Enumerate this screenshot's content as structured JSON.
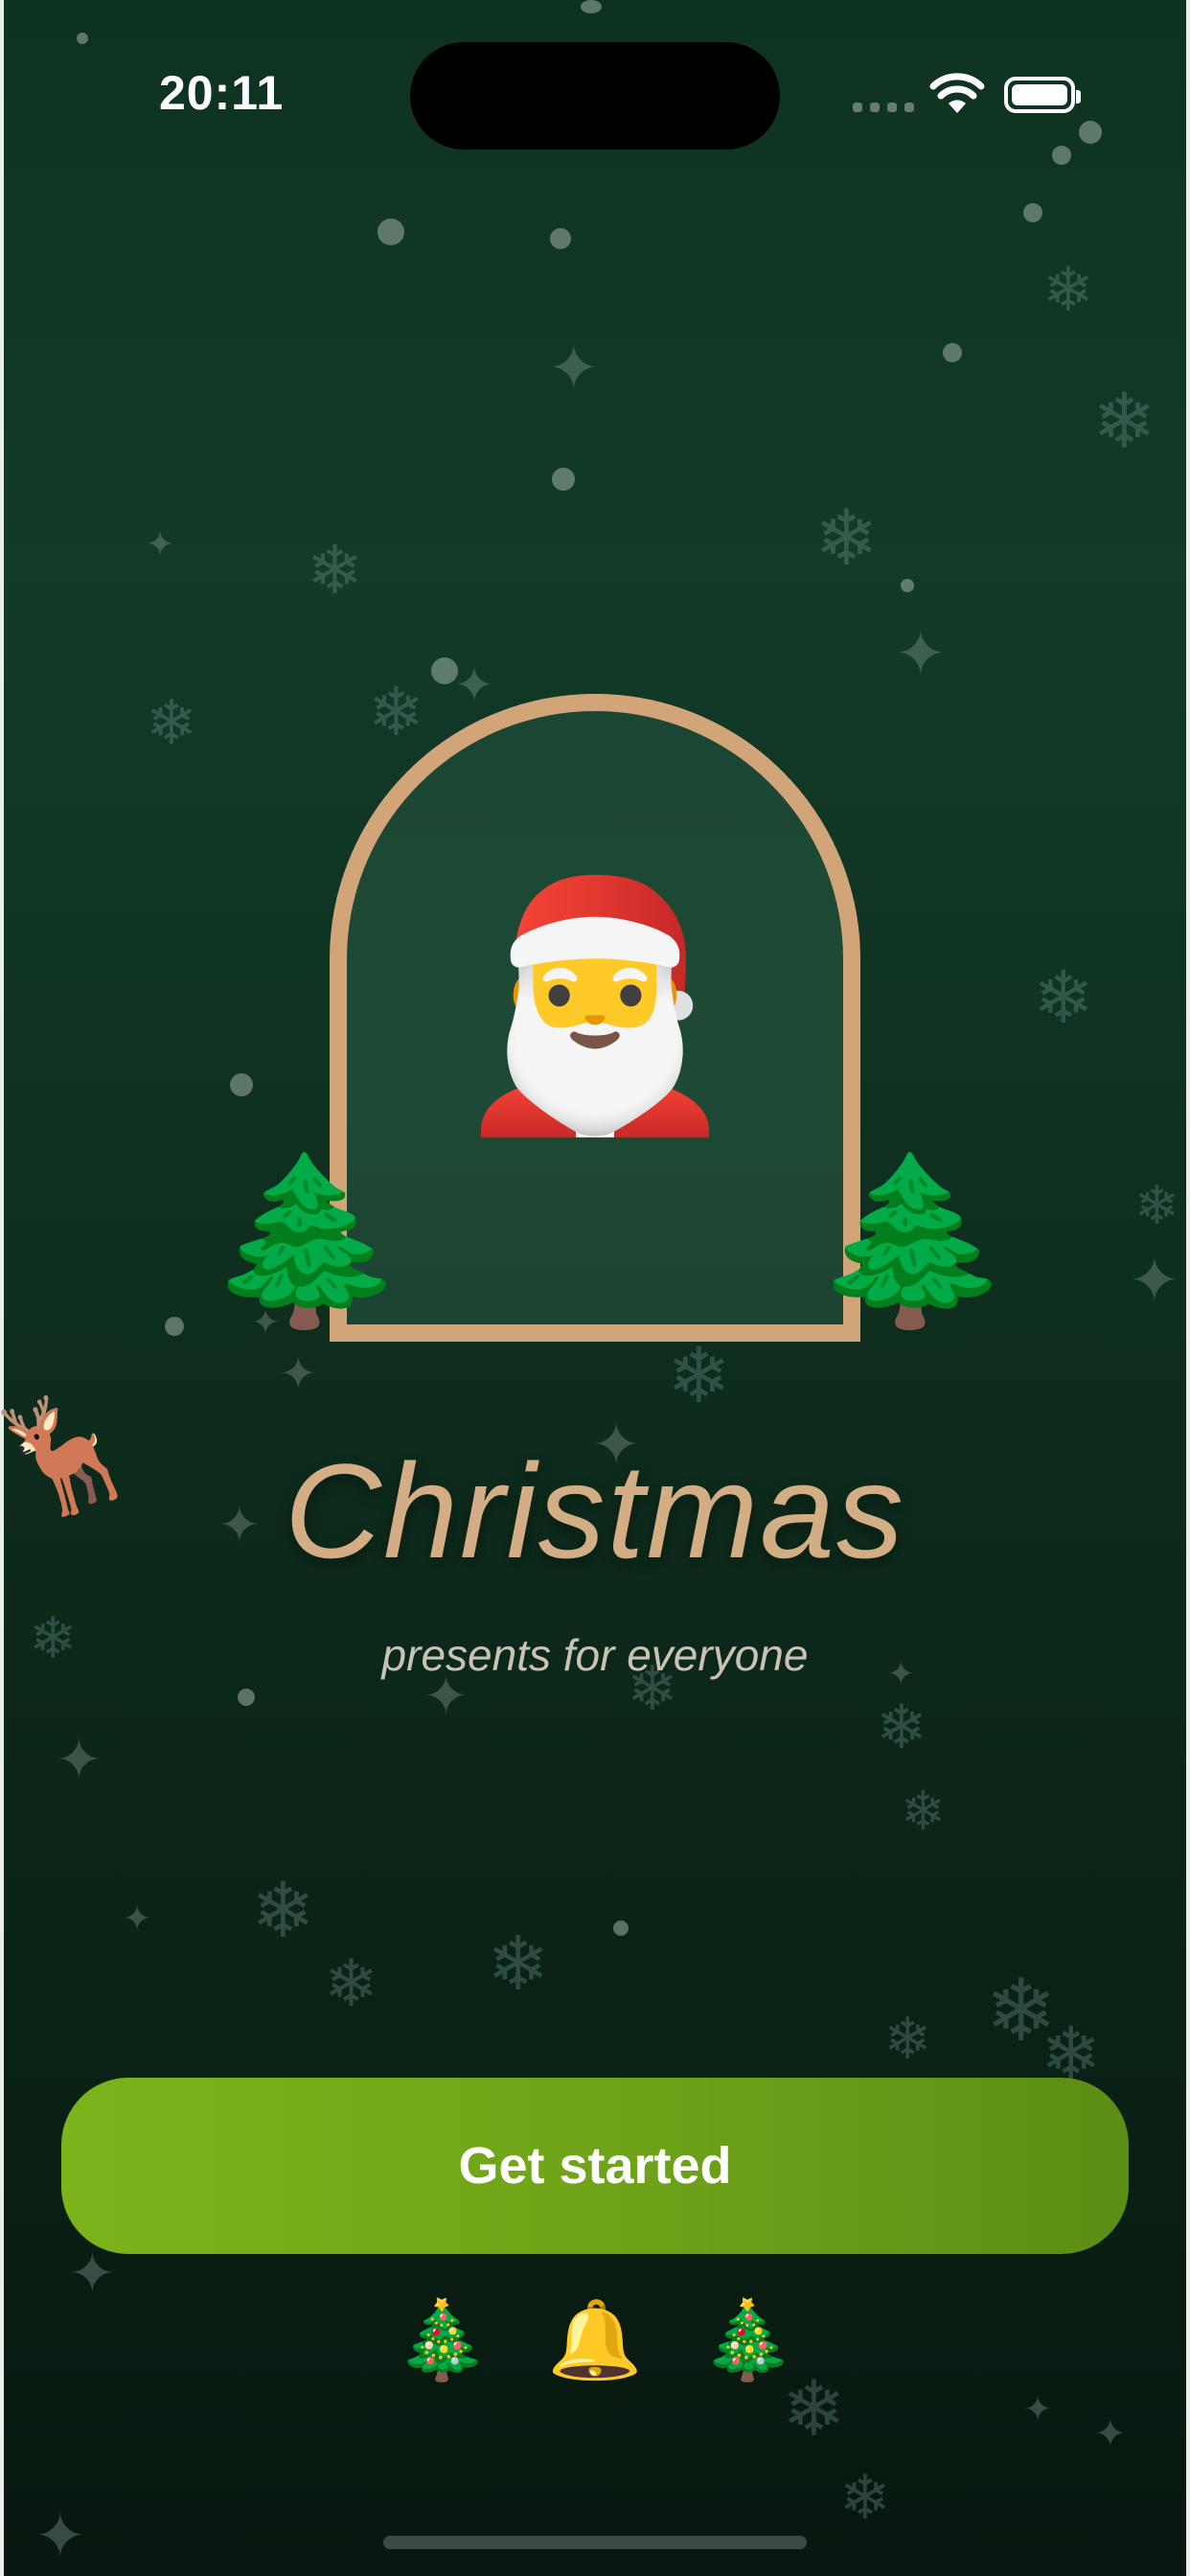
{
  "status_bar": {
    "time": "20:11",
    "icons": [
      "cellular-signal-icon",
      "wifi-icon",
      "battery-icon"
    ]
  },
  "hero": {
    "santa_emoji": "🎅",
    "tree_emoji": "🌲",
    "reindeer_emoji": "🦌"
  },
  "title": "Christmas",
  "subtitle": "presents for everyone",
  "cta": {
    "label": "Get started"
  },
  "bottom_icons": [
    "🎄",
    "🔔",
    "🎄"
  ],
  "colors": {
    "background": "#0e3221",
    "arch_border": "#d2a578",
    "title": "#d3ad84",
    "button": "#74ab1a"
  }
}
